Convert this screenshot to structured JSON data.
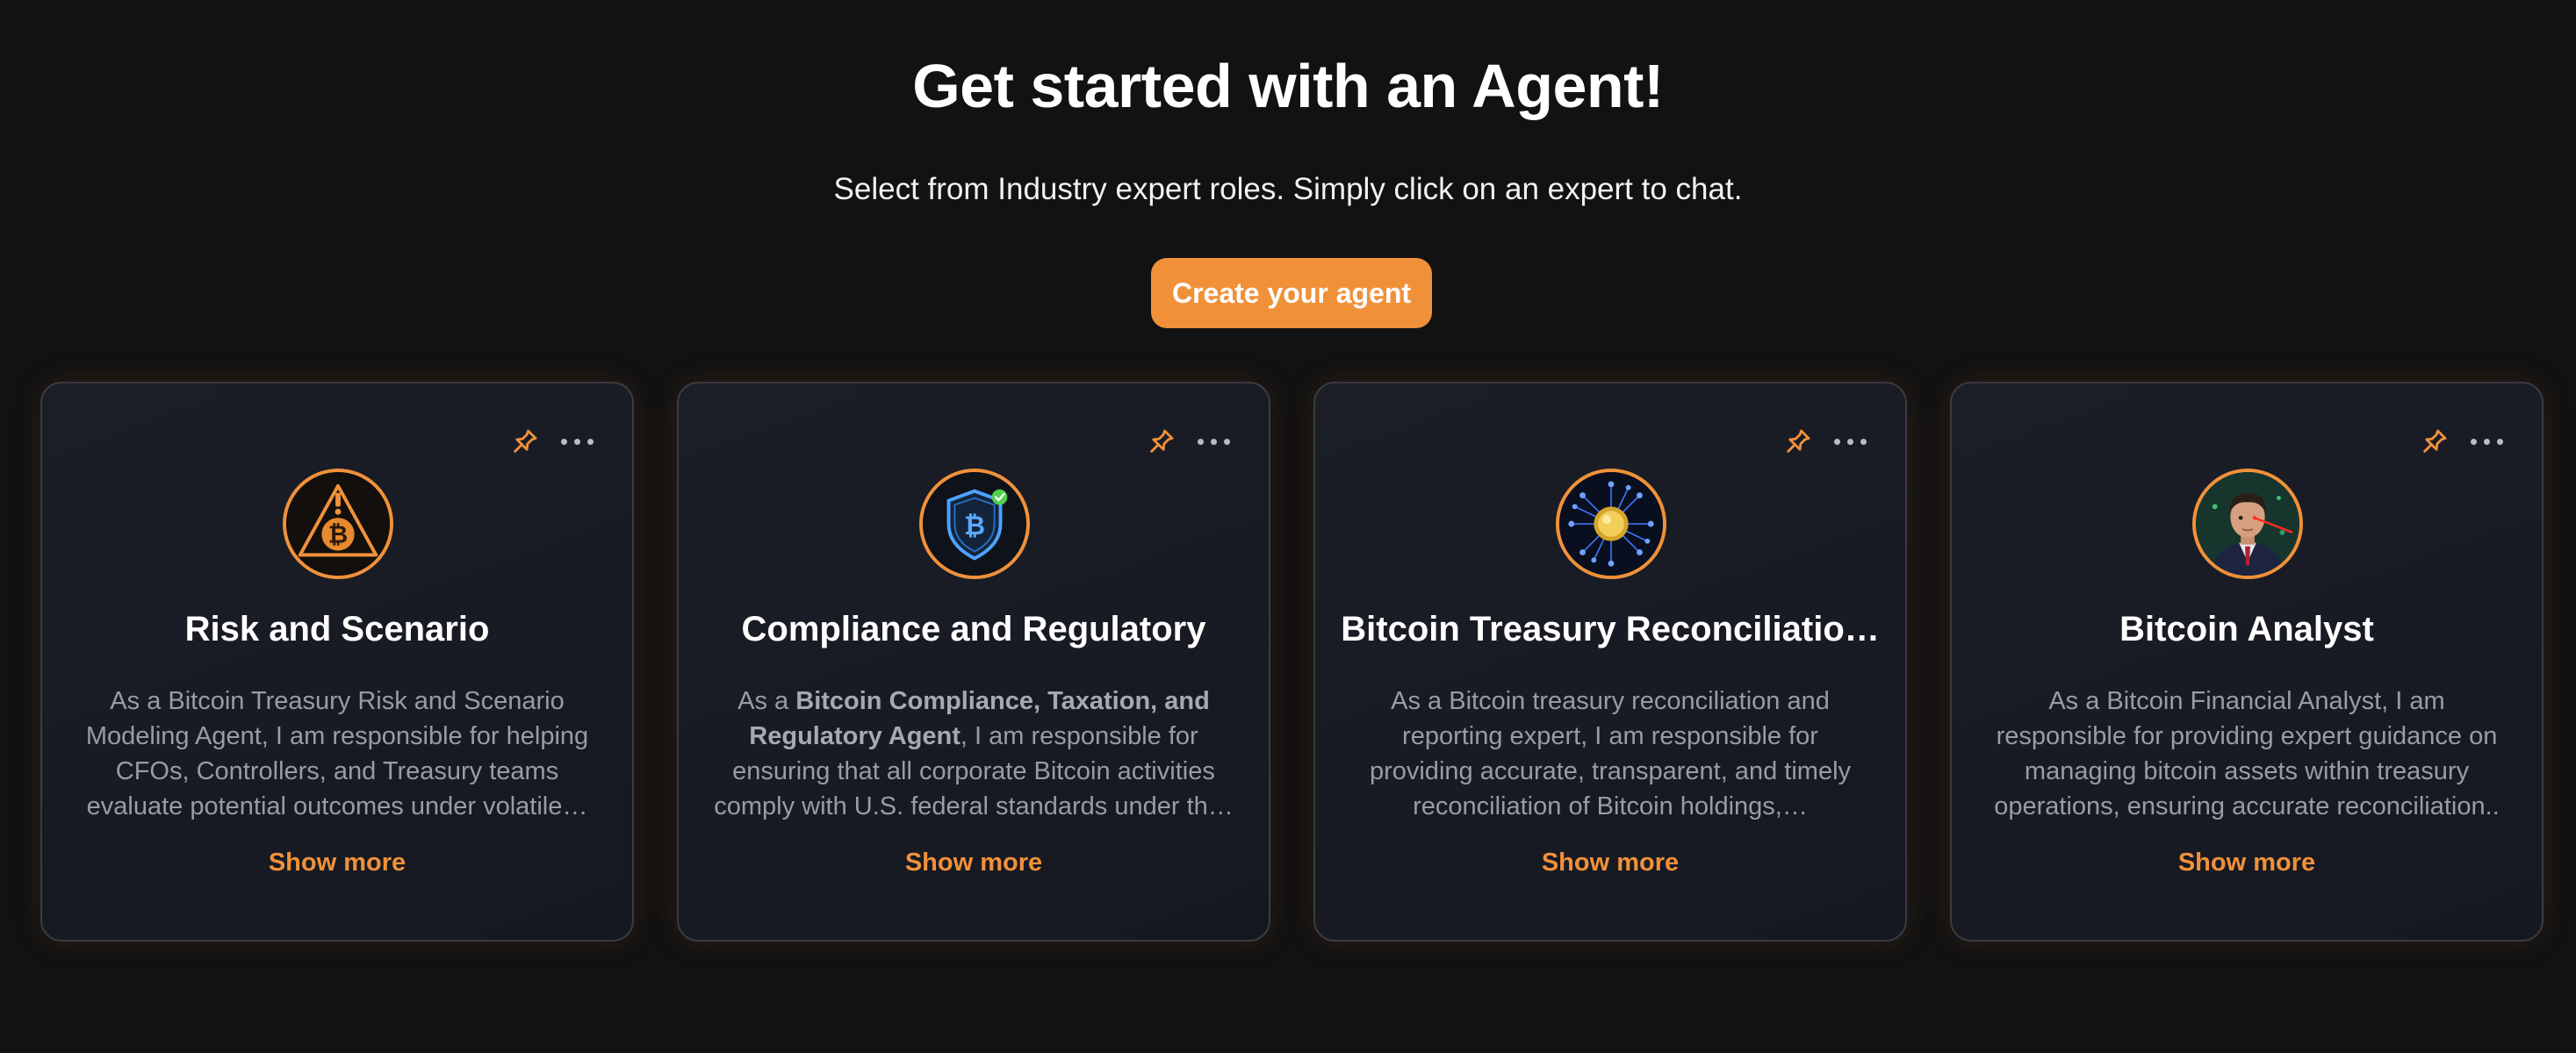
{
  "header": {
    "title": "Get started with an Agent!",
    "subtitle": "Select from Industry expert roles. Simply click on an expert to chat.",
    "create_button_label": "Create your agent"
  },
  "colors": {
    "background": "#121212",
    "accent": "#f0913a",
    "card_border": "#3b3b3f",
    "description_text": "#9a9ca4"
  },
  "cards": [
    {
      "title": "Risk and Scenario",
      "description": "As a Bitcoin Treasury Risk and Scenario Modeling Agent, I am responsible for helping CFOs, Controllers, and Treasury teams evaluate potential outcomes under volatile…",
      "show_more": "Show more",
      "avatar_icon": "bitcoin-warning-triangle-icon",
      "pin_icon": "pin-icon",
      "menu_icon": "more-horizontal-icon"
    },
    {
      "title": "Compliance and Regulatory",
      "description_prefix": "As a ",
      "description_bold": "Bitcoin Compliance, Taxation, and Regulatory Agent",
      "description_rest": ", I am responsible for ensuring that all corporate Bitcoin activities comply with U.S. federal standards under th…",
      "show_more": "Show more",
      "avatar_icon": "bitcoin-shield-check-icon",
      "pin_icon": "pin-icon",
      "menu_icon": "more-horizontal-icon"
    },
    {
      "title": "Bitcoin Treasury Reconciliatio…",
      "description": "As a Bitcoin treasury reconciliation and reporting expert, I am responsible for providing accurate, transparent, and timely reconciliation of Bitcoin holdings,…",
      "show_more": "Show more",
      "avatar_icon": "bitcoin-network-coin-icon",
      "pin_icon": "pin-icon",
      "menu_icon": "more-horizontal-icon"
    },
    {
      "title": "Bitcoin Analyst",
      "description": "As a Bitcoin Financial Analyst, I am responsible for providing expert guidance on managing bitcoin assets within treasury operations, ensuring accurate reconciliation..",
      "show_more": "Show more",
      "avatar_icon": "analyst-portrait-avatar",
      "pin_icon": "pin-icon",
      "menu_icon": "more-horizontal-icon"
    }
  ]
}
